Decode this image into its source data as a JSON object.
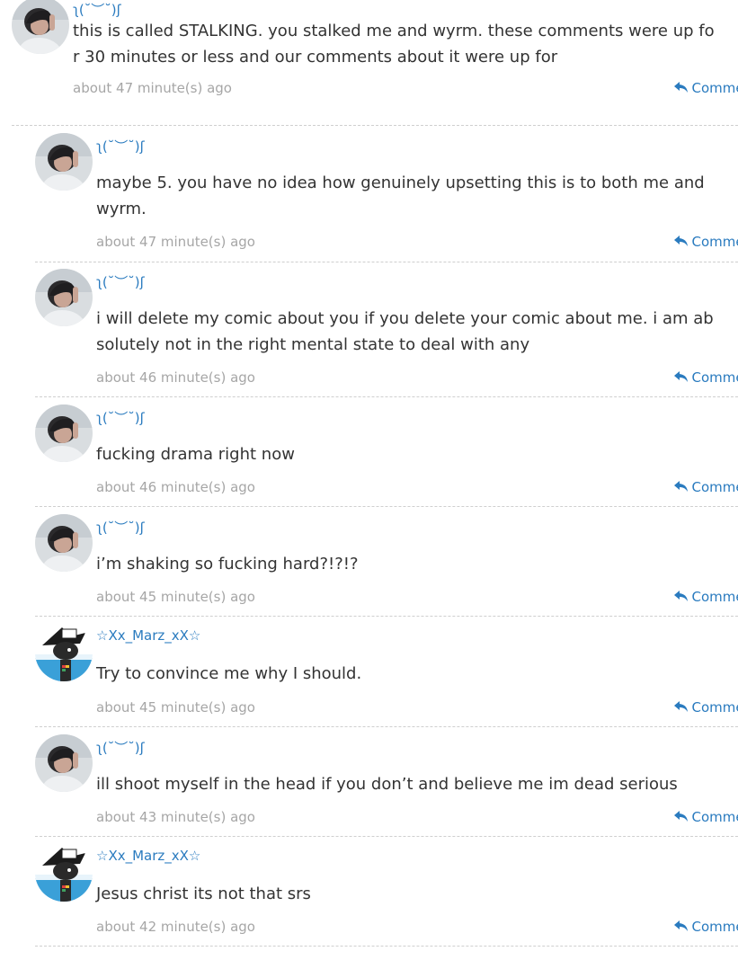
{
  "comment_link_label": "Comment",
  "comments": [
    {
      "author": "ʅ(˘︶˘)ʃ",
      "avatar": "user-photo",
      "text": "this is called STALKING. you stalked me and wyrm. these comments were up fo\nr 30 minutes or less and our comments about it were up for",
      "time": "about 47 minute(s) ago"
    },
    {
      "author": "ʅ(˘︶˘)ʃ",
      "avatar": "user-photo",
      "text": "maybe 5. you have no idea how genuinely upsetting this is to both me and\nwyrm.",
      "time": "about 47 minute(s) ago"
    },
    {
      "author": "ʅ(˘︶˘)ʃ",
      "avatar": "user-photo",
      "text": "i will delete my comic about you if you delete your comic about me. i am ab\nsolutely not in the right mental state to deal with any",
      "time": "about 46 minute(s) ago"
    },
    {
      "author": "ʅ(˘︶˘)ʃ",
      "avatar": "user-photo",
      "text": "fucking drama right now",
      "time": "about 46 minute(s) ago"
    },
    {
      "author": "ʅ(˘︶˘)ʃ",
      "avatar": "user-photo",
      "text": "i’m shaking so fucking hard?!?!?",
      "time": "about 45 minute(s) ago"
    },
    {
      "author": "☆Xx_Marz_xX☆",
      "avatar": "character-drawing",
      "text": "Try to convince me why I should.",
      "time": "about 45 minute(s) ago"
    },
    {
      "author": "ʅ(˘︶˘)ʃ",
      "avatar": "user-photo",
      "text": "ill shoot myself in the head if you don’t and believe me im dead serious",
      "time": "about 43 minute(s) ago"
    },
    {
      "author": "☆Xx_Marz_xX☆",
      "avatar": "character-drawing",
      "text": "Jesus christ its not that srs",
      "time": "about 42 minute(s) ago"
    }
  ]
}
